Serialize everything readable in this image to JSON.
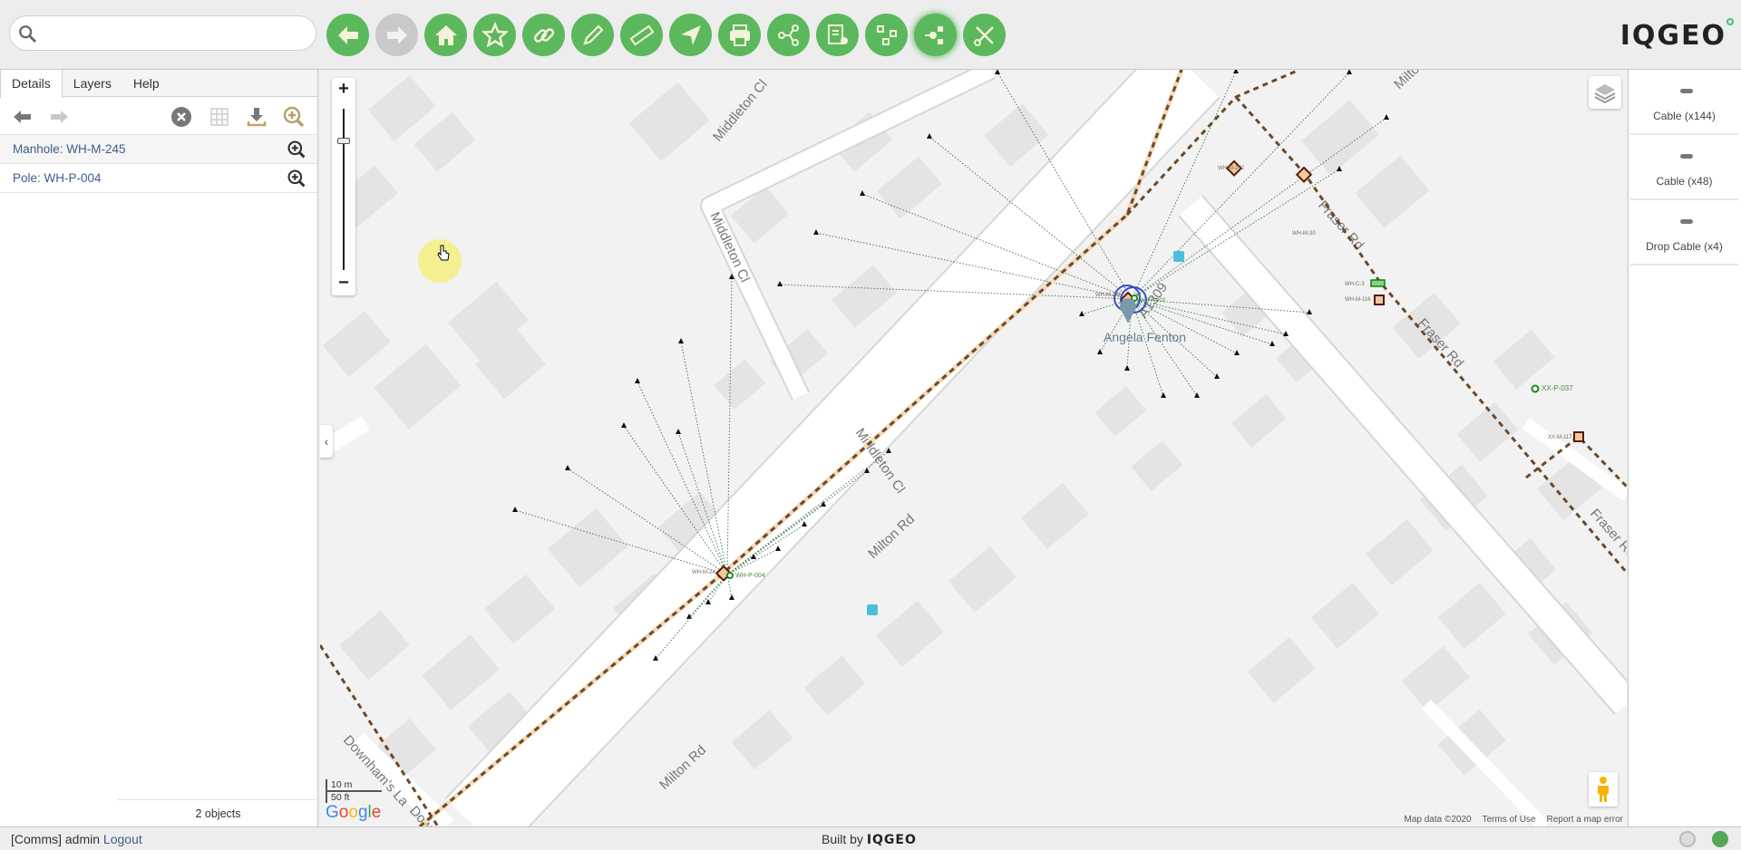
{
  "search": {
    "placeholder": "",
    "value": ""
  },
  "toolbar": {
    "buttons": [
      {
        "name": "back",
        "icon": "arrow-left-icon",
        "enabled": true
      },
      {
        "name": "forward",
        "icon": "arrow-right-icon",
        "enabled": false
      },
      {
        "name": "home",
        "icon": "home-icon",
        "enabled": true
      },
      {
        "name": "bookmarks",
        "icon": "star-icon",
        "enabled": true
      },
      {
        "name": "link",
        "icon": "link-icon",
        "enabled": true
      },
      {
        "name": "edit",
        "icon": "pencil-icon",
        "enabled": true
      },
      {
        "name": "measure",
        "icon": "ruler-icon",
        "enabled": true
      },
      {
        "name": "locate",
        "icon": "navigation-arrow-icon",
        "enabled": true
      },
      {
        "name": "print",
        "icon": "printer-icon",
        "enabled": true
      },
      {
        "name": "trace",
        "icon": "share-network-icon",
        "enabled": true
      },
      {
        "name": "settings-report",
        "icon": "report-settings-icon",
        "enabled": true
      },
      {
        "name": "schematic",
        "icon": "schematic-icon",
        "enabled": true
      },
      {
        "name": "connections",
        "icon": "plug-connector-icon",
        "enabled": true,
        "active": true
      },
      {
        "name": "tools",
        "icon": "tools-icon",
        "enabled": true
      }
    ],
    "logo": "IQGEO"
  },
  "leftpanel": {
    "tabs": [
      {
        "label": "Details",
        "active": true
      },
      {
        "label": "Layers",
        "active": false
      },
      {
        "label": "Help",
        "active": false
      }
    ],
    "results": [
      {
        "label": "Manhole: WH-M-245",
        "selected": true
      },
      {
        "label": "Pole: WH-P-004",
        "selected": false
      }
    ],
    "object_count": "2 objects"
  },
  "map": {
    "road_labels": [
      "Middleton Cl",
      "Middleton Cl",
      "Middleton Cl",
      "Milton Rd",
      "Milton Rd",
      "Milton Rd",
      "Fraser Rd",
      "Fraser Rd",
      "Fraser Rd",
      "A1309",
      "Downham's La",
      "Dow"
    ],
    "poi": "Angela Fenton",
    "asset_labels": {
      "manhole_top": "WH-M-245",
      "pole_top": "WH-P-003",
      "manhole_252": "WH-M-252",
      "manhole_fraser": "WH-M-30",
      "cabinet": "WH-C-3",
      "manhole_116": "WH-M-116",
      "pole_xx": "XX-P-037",
      "manhole_xx": "XX-M-117",
      "manhole_bottom": "WH-M-24",
      "pole_bottom": "WH-P-004"
    },
    "scale": {
      "metric": "10 m",
      "imperial": "50 ft"
    },
    "attribution": [
      "Map data ©2020",
      "Terms of Use",
      "Report a map error"
    ],
    "zoom_level_fraction": 0.15
  },
  "rightpanel": {
    "cards": [
      {
        "label": "Cable (x144)"
      },
      {
        "label": "Cable (x48)"
      },
      {
        "label": "Drop Cable (x4)"
      }
    ]
  },
  "statusbar": {
    "user": "[Comms] admin",
    "logout": "Logout",
    "built_by": "Built by",
    "built_by_brand": "IQGEO"
  },
  "colors": {
    "accent": "#5cb85c",
    "link": "#3f5d8a",
    "cable": "#6b4a2b",
    "drop": "#4a7a5a",
    "selection": "#3b4fc0"
  }
}
